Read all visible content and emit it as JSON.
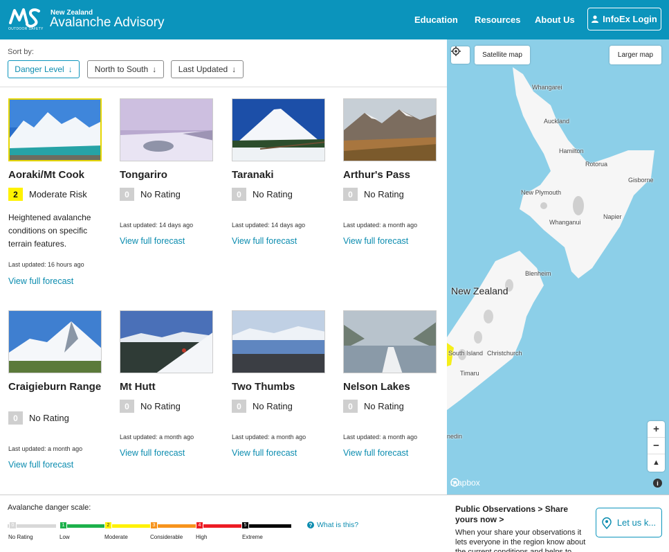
{
  "header": {
    "logo_sub": "OUTDOOR SAFETY",
    "brand_small": "New Zealand",
    "brand_big": "Avalanche Advisory",
    "nav": [
      "Education",
      "Resources",
      "About Us"
    ],
    "login_label": "InfoEx Login"
  },
  "sort": {
    "label": "Sort by:",
    "buttons": [
      "Danger Level",
      "North to South",
      "Last Updated"
    ],
    "active": "Danger Level"
  },
  "regions": [
    {
      "name": "Aoraki/Mt Cook",
      "rating_num": "2",
      "rating_text": "Moderate Risk",
      "description": "Heightened avalanche conditions on specific terrain features.",
      "updated": "Last updated: 16 hours ago",
      "link": "View full forecast"
    },
    {
      "name": "Tongariro",
      "rating_num": "0",
      "rating_text": "No Rating",
      "updated": "Last updated: 14 days ago",
      "link": "View full forecast"
    },
    {
      "name": "Taranaki",
      "rating_num": "0",
      "rating_text": "No Rating",
      "updated": "Last updated: 14 days ago",
      "link": "View full forecast"
    },
    {
      "name": "Arthur's Pass",
      "rating_num": "0",
      "rating_text": "No Rating",
      "updated": "Last updated: a month ago",
      "link": "View full forecast"
    },
    {
      "name": "Craigieburn Range",
      "rating_num": "0",
      "rating_text": "No Rating",
      "updated": "Last updated: a month ago",
      "link": "View full forecast"
    },
    {
      "name": "Mt Hutt",
      "rating_num": "0",
      "rating_text": "No Rating",
      "updated": "Last updated: a month ago",
      "link": "View full forecast"
    },
    {
      "name": "Two Thumbs",
      "rating_num": "0",
      "rating_text": "No Rating",
      "updated": "Last updated: a month ago",
      "link": "View full forecast"
    },
    {
      "name": "Nelson Lakes",
      "rating_num": "0",
      "rating_text": "No Rating",
      "updated": "Last updated: a month ago",
      "link": "View full forecast"
    }
  ],
  "map": {
    "satellite_label": "Satellite map",
    "larger_label": "Larger map",
    "zoom_in": "+",
    "zoom_out": "−",
    "compass": "▲",
    "labels": [
      "Whangarei",
      "Auckland",
      "Hamilton",
      "Rotorua",
      "Gisborne",
      "New Plymouth",
      "Whanganui",
      "Napier",
      "Blenheim",
      "New Zealand",
      "South Island",
      "Christchurch",
      "Timaru",
      "nedin"
    ],
    "attribution": "mapbox",
    "info": "i"
  },
  "scale": {
    "title": "Avalanche danger scale:",
    "levels": [
      {
        "num": "0",
        "label": "No Rating",
        "color": "#d8d8d8"
      },
      {
        "num": "1",
        "label": "Low",
        "color": "#1db14b"
      },
      {
        "num": "2",
        "label": "Moderate",
        "color": "#fff200"
      },
      {
        "num": "3",
        "label": "Considerable",
        "color": "#f7941d"
      },
      {
        "num": "4",
        "label": "High",
        "color": "#ed1c24"
      },
      {
        "num": "5",
        "label": "Extreme",
        "color": "#000000"
      }
    ],
    "what_is_this": "What is this?"
  },
  "observations": {
    "title": "Public Observations > Share yours now >",
    "text": "When your share your observations it lets everyone in the region know about the current conditions and helps to keep",
    "button": "Let us k..."
  },
  "colors": {
    "brand": "#0b94bc",
    "link": "#0b8caf",
    "map_water": "#8ccfe8"
  }
}
